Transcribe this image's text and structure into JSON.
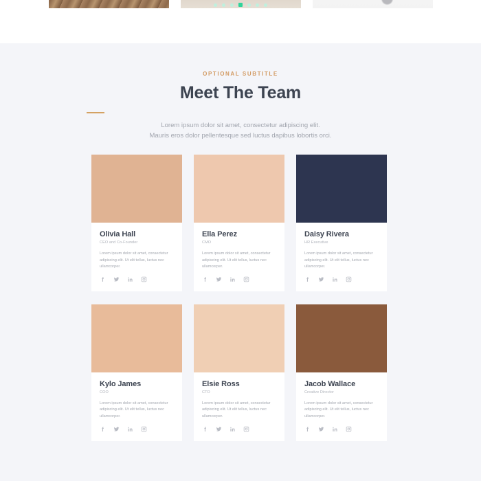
{
  "carousel": {
    "slides": [
      {
        "name": "slide-wood-texture"
      },
      {
        "name": "slide-neutral-texture"
      },
      {
        "name": "slide-light-object"
      }
    ],
    "dots": [
      {
        "label": "1",
        "active": false
      },
      {
        "label": "2",
        "active": false
      },
      {
        "label": "3",
        "active": false
      },
      {
        "label": "4",
        "active": true
      },
      {
        "label": "5",
        "active": false
      },
      {
        "label": "6",
        "active": false
      },
      {
        "label": "7",
        "active": false
      }
    ],
    "active_dot_color": "#2fd49a",
    "inactive_dot_color": "#bff0dd"
  },
  "section": {
    "subtitle": "OPTIONAL SUBTITLE",
    "title": "Meet The Team",
    "subtitle_color": "#d29a62",
    "divider_color": "#d4a263",
    "title_color": "#3d4451",
    "background_color": "#f4f5f9",
    "lead_line_1": "Lorem ipsum dolor sit amet, consectetur adipiscing elit.",
    "lead_line_2": "Mauris eros dolor pellentesque sed luctus dapibus lobortis orci."
  },
  "bio_text": "Lorem ipsum dolor sit amet, consectetur adipiscing elit. Ut elit tellus, luctus nec ullamcorper.",
  "social_labels": {
    "facebook": "facebook-icon",
    "twitter": "twitter-icon",
    "linkedin": "linkedin-icon",
    "instagram": "instagram-icon"
  },
  "team": [
    {
      "name": "Olivia Hall",
      "role": "CEO and Co-Founder",
      "bio": "Lorem ipsum dolor sit amet, consectetur adipiscing elit. Ut elit tellus, luctus nec ullamcorper.",
      "photo": "photo-olivia"
    },
    {
      "name": "Ella Perez",
      "role": "CMO",
      "bio": "Lorem ipsum dolor sit amet, consectetur adipiscing elit. Ut elit tellus, luctus nec ullamcorper.",
      "photo": "photo-ella"
    },
    {
      "name": "Daisy Rivera",
      "role": "HR Executive",
      "bio": "Lorem ipsum dolor sit amet, consectetur adipiscing elit. Ut elit tellus, luctus nec ullamcorper.",
      "photo": "photo-daisy"
    },
    {
      "name": "Kylo James",
      "role": "COO",
      "bio": "Lorem ipsum dolor sit amet, consectetur adipiscing elit. Ut elit tellus, luctus nec ullamcorper.",
      "photo": "photo-kylo"
    },
    {
      "name": "Elsie Ross",
      "role": "CTO",
      "bio": "Lorem ipsum dolor sit amet, consectetur adipiscing elit. Ut elit tellus, luctus nec ullamcorper.",
      "photo": "photo-elsie"
    },
    {
      "name": "Jacob Wallace",
      "role": "Creative Director",
      "bio": "Lorem ipsum dolor sit amet, consectetur adipiscing elit. Ut elit tellus, luctus nec ullamcorper.",
      "photo": "photo-jacob"
    }
  ]
}
